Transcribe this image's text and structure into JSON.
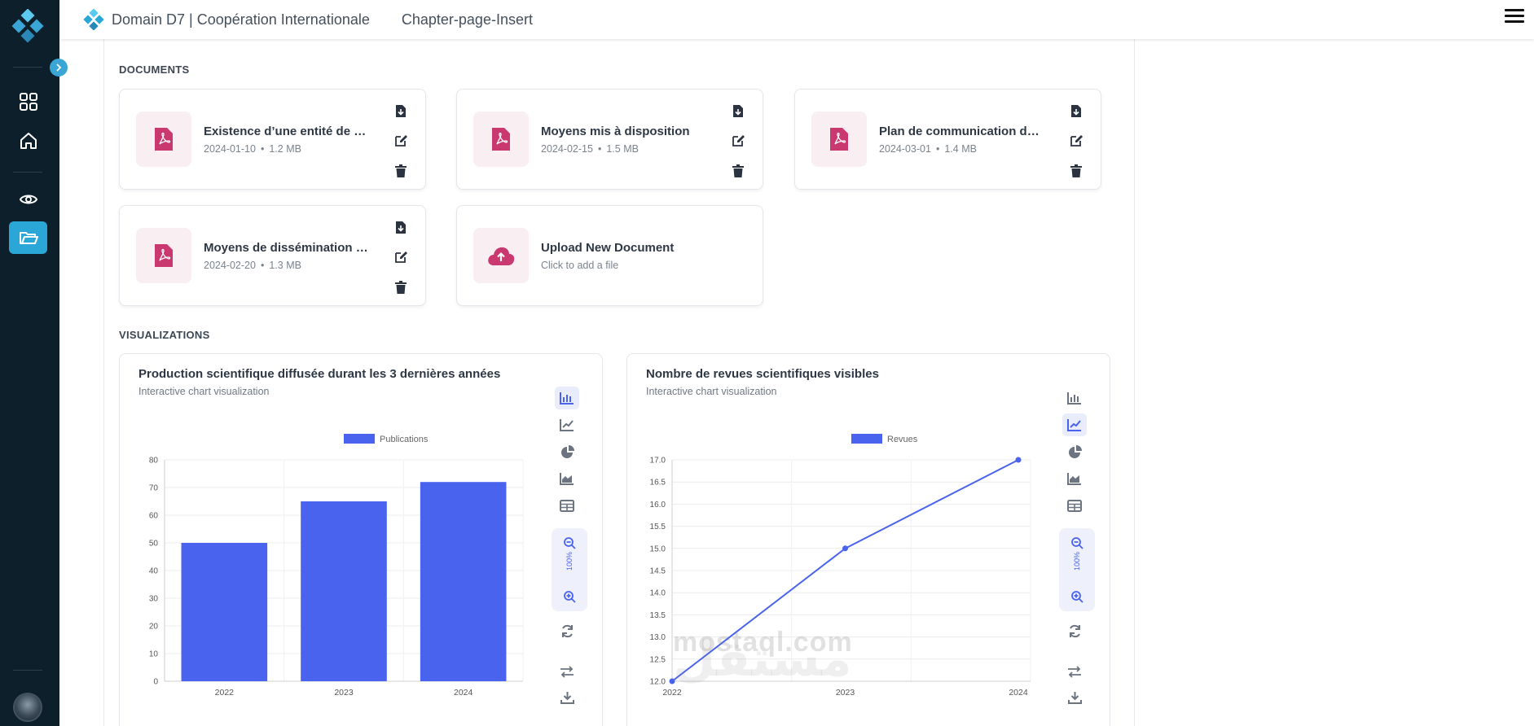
{
  "app": {
    "title": "Domain D7 | Coopération Internationale",
    "subtitle": "Chapter-page-Insert",
    "brand_color": "#2aa7d6"
  },
  "sidebar": {
    "items": [
      {
        "icon": "grid-icon",
        "active": false
      },
      {
        "icon": "home-icon",
        "active": false
      },
      {
        "icon": "eye-icon",
        "active": false
      },
      {
        "icon": "folder-open-icon",
        "active": true
      }
    ]
  },
  "documents": {
    "section_title": "DOCUMENTS",
    "items": [
      {
        "name": "Existence d’une entité de c...",
        "date": "2024-01-10",
        "size": "1.2 MB"
      },
      {
        "name": "Moyens mis à disposition",
        "date": "2024-02-15",
        "size": "1.5 MB"
      },
      {
        "name": "Plan de communication de l...",
        "date": "2024-03-01",
        "size": "1.4 MB"
      },
      {
        "name": "Moyens de dissémination d...",
        "date": "2024-02-20",
        "size": "1.3 MB"
      }
    ],
    "upload": {
      "title": "Upload New Document",
      "subtitle": "Click to add a file"
    }
  },
  "visualizations": {
    "section_title": "VISUALIZATIONS",
    "zoom_level": "100%"
  },
  "chart_data": [
    {
      "type": "bar",
      "title": "Production scientifique diffusée durant les 3 dernières années",
      "subtitle": "Interactive chart visualization",
      "categories": [
        "2022",
        "2023",
        "2024"
      ],
      "series": [
        {
          "name": "Publications",
          "values": [
            50,
            65,
            72
          ],
          "color": "#4a63ee"
        }
      ],
      "ylim": [
        0,
        80
      ],
      "yticks": [
        0,
        10,
        20,
        30,
        40,
        50,
        60,
        70,
        80
      ],
      "grid": true,
      "legend": "top-center",
      "active_tool": "bar"
    },
    {
      "type": "line",
      "title": "Nombre de revues scientifiques visibles",
      "subtitle": "Interactive chart visualization",
      "categories": [
        "2022",
        "2023",
        "2024"
      ],
      "series": [
        {
          "name": "Revues",
          "values": [
            12.0,
            15.0,
            17.0
          ],
          "color": "#4a63ee"
        }
      ],
      "ylim": [
        12.0,
        17.0
      ],
      "yticks": [
        "12.0",
        "12.5",
        "13.0",
        "13.5",
        "14.0",
        "14.5",
        "15.0",
        "15.5",
        "16.0",
        "16.5",
        "17.0"
      ],
      "grid": true,
      "legend": "top-center",
      "active_tool": "line"
    }
  ],
  "watermark": {
    "latin": "mostaql.com",
    "arabic": "مستقل"
  }
}
